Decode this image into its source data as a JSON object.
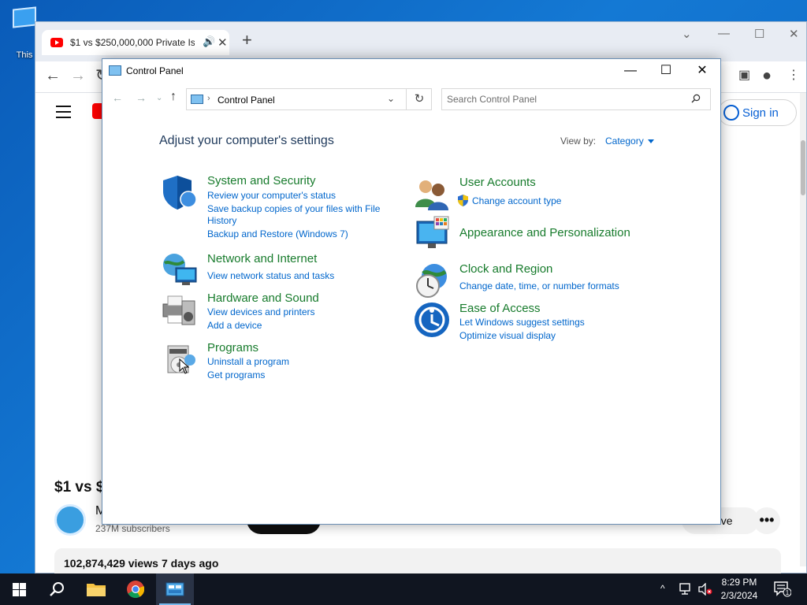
{
  "desktop": {
    "icon_label": "This"
  },
  "chrome": {
    "tab_title": "$1 vs $250,000,000 Private Is",
    "audio_icon": "speaker-icon",
    "close_glyph": "✕",
    "newtab_glyph": "+"
  },
  "youtube": {
    "signin_label": "Sign in",
    "video_title": "$1 vs $",
    "channel_initial": "M",
    "subscribers": "237M subscribers",
    "save_label": "ave",
    "more_glyph": "•••",
    "views": "102,874,429 views",
    "age": "7 days ago"
  },
  "control_panel": {
    "window_title": "Control Panel",
    "minimize_glyph": "—",
    "maximize_glyph": "☐",
    "close_glyph": "✕",
    "address_text": "Control Panel",
    "search_placeholder": "Search Control Panel",
    "heading": "Adjust your computer's settings",
    "view_by_label": "View by:",
    "view_by_value": "Category",
    "categories": [
      {
        "title": "System and Security",
        "icon": "shield-icon",
        "links": [
          "Review your computer's status",
          "Save backup copies of your files with File",
          "History",
          "Backup and Restore (Windows 7)"
        ]
      },
      {
        "title": "Network and Internet",
        "icon": "network-globe-icon",
        "links": [
          "View network status and tasks"
        ]
      },
      {
        "title": "Hardware and Sound",
        "icon": "printer-speaker-icon",
        "links": [
          "View devices and printers",
          "Add a device"
        ]
      },
      {
        "title": "Programs",
        "icon": "programs-disc-icon",
        "links": [
          "Uninstall a program",
          "Get programs"
        ]
      },
      {
        "title": "User Accounts",
        "icon": "users-icon",
        "links": [
          "Change account type"
        ]
      },
      {
        "title": "Appearance and Personalization",
        "icon": "monitor-palette-icon",
        "links": []
      },
      {
        "title": "Clock and Region",
        "icon": "clock-globe-icon",
        "links": [
          "Change date, time, or number formats"
        ]
      },
      {
        "title": "Ease of Access",
        "icon": "ease-of-access-icon",
        "links": [
          "Let Windows suggest settings",
          "Optimize visual display"
        ]
      }
    ]
  },
  "taskbar": {
    "time": "8:29 PM",
    "date": "2/3/2024",
    "notification_count": "1",
    "tray_chevron": "^"
  },
  "colors": {
    "link_blue": "#0066cc",
    "category_green": "#177b2c",
    "heading_blue": "#1e395b",
    "taskbar": "#101520",
    "youtube_red": "#ff0000"
  }
}
